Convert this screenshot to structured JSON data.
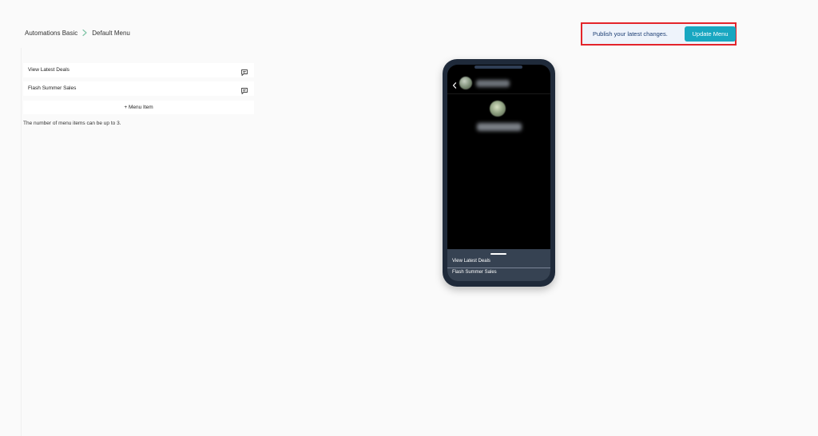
{
  "breadcrumb": {
    "parent": "Automations Basic",
    "current": "Default Menu",
    "separator_icon": "chevron-right-icon",
    "separator_color": "#7fc4a6"
  },
  "publish": {
    "message": "Publish your latest changes.",
    "button_label": "Update Menu",
    "button_color": "#18a7c1",
    "highlight_color": "#e3242b"
  },
  "menu": {
    "items": [
      {
        "label": "View Latest Deals",
        "icon": "message-reply-icon"
      },
      {
        "label": "Flash Summer Sales",
        "icon": "message-reply-icon"
      }
    ],
    "add_label": "+ Menu Item",
    "hint": "The number of menu items can be up to 3."
  },
  "phone_preview": {
    "back_icon": "chevron-left-icon",
    "sheet_items": [
      {
        "label": "View Latest Deals"
      },
      {
        "label": "Flash Summer Sales"
      }
    ]
  }
}
